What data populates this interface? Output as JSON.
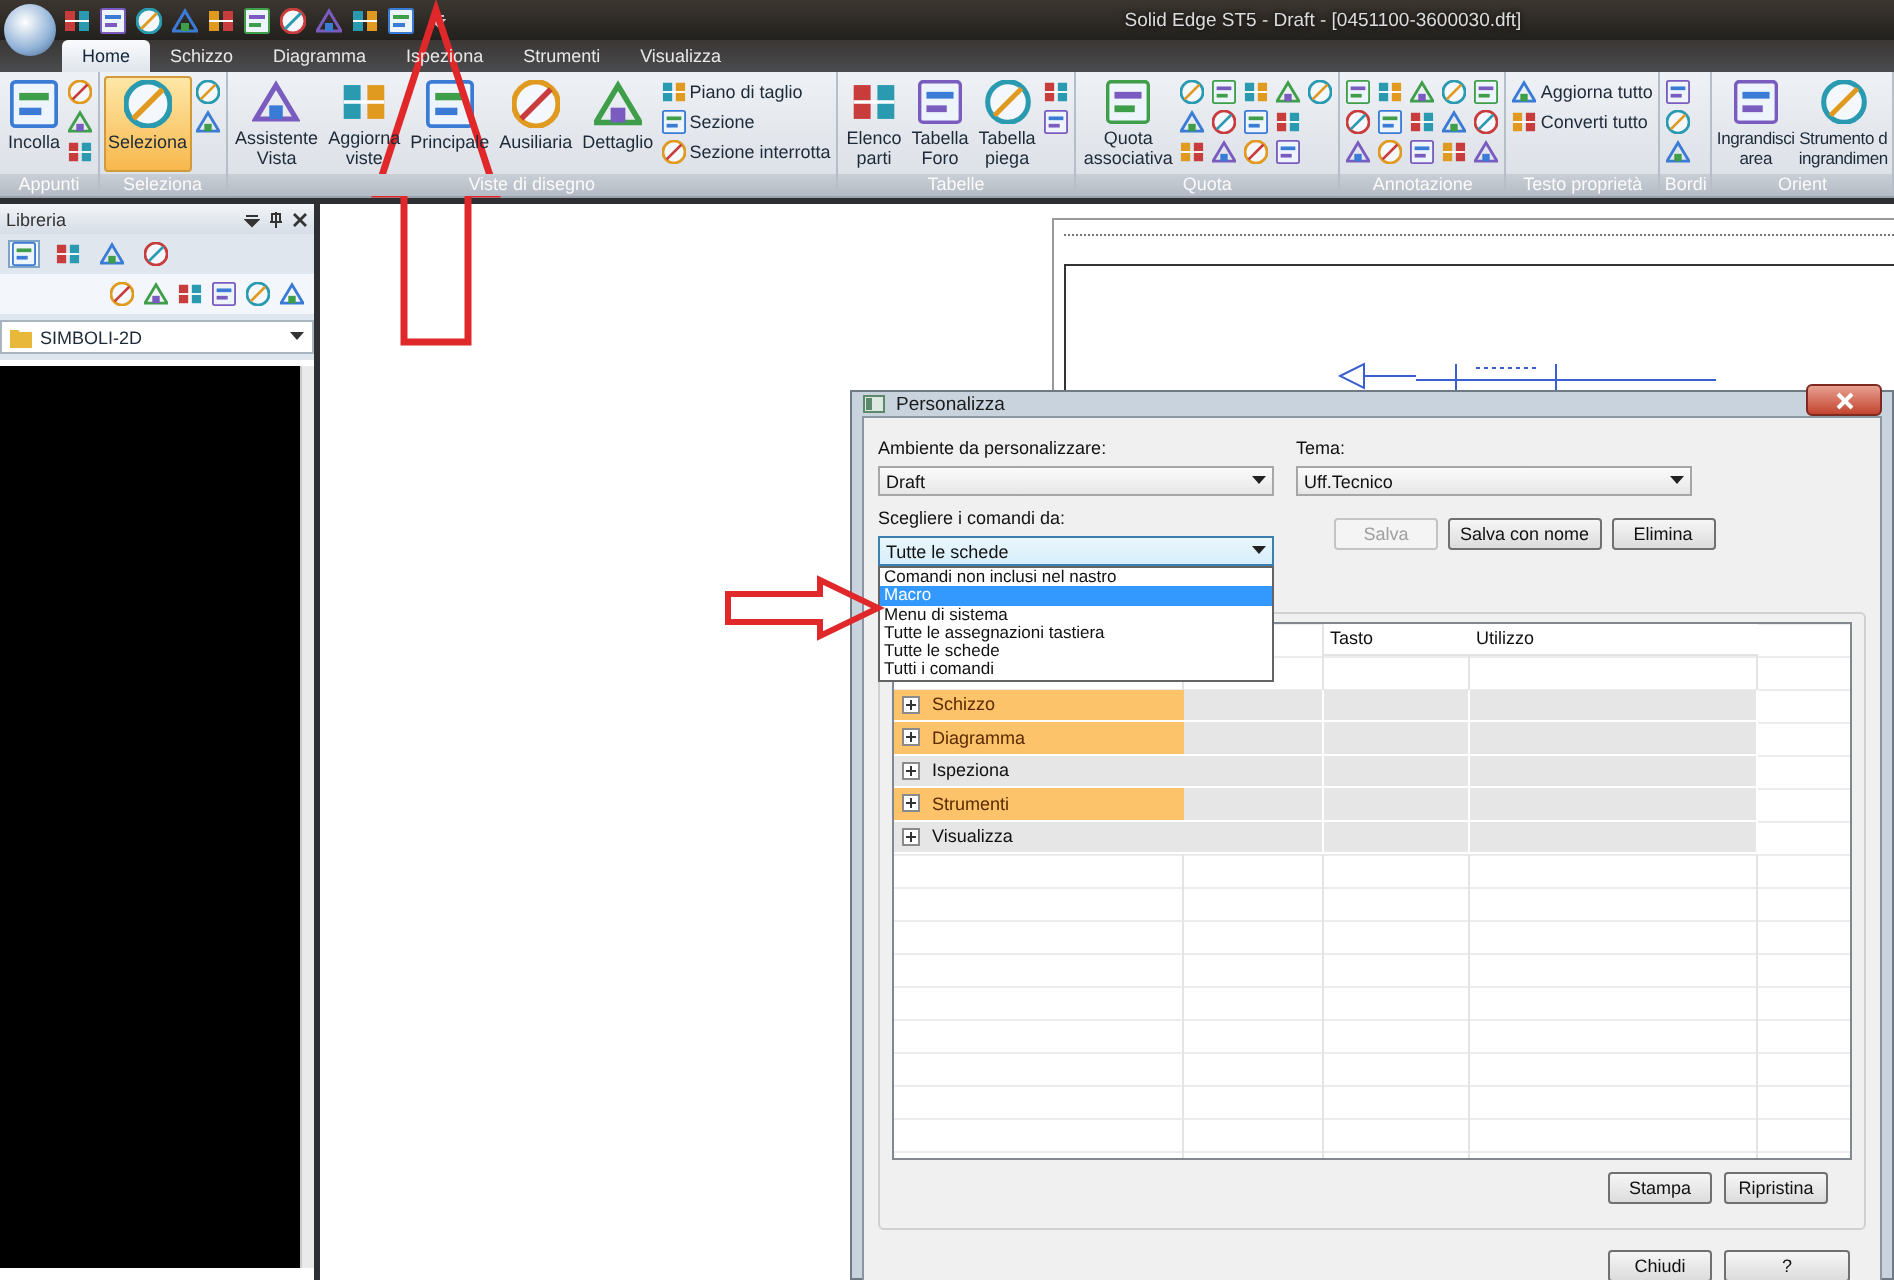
{
  "window": {
    "title": "Solid Edge ST5 - Draft - [0451100-3600030.dft]"
  },
  "tabs": [
    {
      "label": "Home",
      "selected": true
    },
    {
      "label": "Schizzo",
      "selected": false
    },
    {
      "label": "Diagramma",
      "selected": false
    },
    {
      "label": "Ispeziona",
      "selected": false
    },
    {
      "label": "Strumenti",
      "selected": false
    },
    {
      "label": "Visualizza",
      "selected": false
    }
  ],
  "ribbon": {
    "groups": [
      {
        "label": "Appunti",
        "items": [
          {
            "kind": "large",
            "label": "Incolla",
            "selected": false
          },
          {
            "kind": "icon",
            "selected": false
          },
          {
            "kind": "icon",
            "selected": false
          },
          {
            "kind": "icon",
            "selected": false
          }
        ]
      },
      {
        "label": "Seleziona",
        "items": [
          {
            "kind": "large",
            "label": "Seleziona",
            "selected": true
          },
          {
            "kind": "icon",
            "selected": false
          },
          {
            "kind": "icon",
            "selected": false
          }
        ]
      },
      {
        "label": "Viste di disegno",
        "items": [
          {
            "kind": "large",
            "label": "Assistente\nVista",
            "selected": false
          },
          {
            "kind": "large",
            "label": "Aggiorna\nviste",
            "selected": false
          },
          {
            "kind": "large",
            "label": "Principale",
            "selected": false
          },
          {
            "kind": "large",
            "label": "Ausiliaria",
            "selected": false
          },
          {
            "kind": "large",
            "label": "Dettaglio",
            "selected": false
          },
          {
            "kind": "small",
            "label": "Piano di taglio",
            "selected": false
          },
          {
            "kind": "small",
            "label": "Sezione",
            "selected": false
          },
          {
            "kind": "small",
            "label": "Sezione interrotta",
            "selected": false
          }
        ]
      },
      {
        "label": "Tabelle",
        "items": [
          {
            "kind": "large",
            "label": "Elenco\nparti",
            "selected": false
          },
          {
            "kind": "large",
            "label": "Tabella\nForo",
            "selected": false
          },
          {
            "kind": "large",
            "label": "Tabella\npiega",
            "selected": false
          },
          {
            "kind": "icon",
            "selected": false
          },
          {
            "kind": "icon",
            "selected": false
          }
        ]
      },
      {
        "label": "Quota",
        "items": [
          {
            "kind": "large",
            "label": "Quota\nassociativa",
            "selected": false
          },
          {
            "kind": "icon",
            "selected": false
          },
          {
            "kind": "icon",
            "selected": false
          },
          {
            "kind": "icon",
            "selected": false
          },
          {
            "kind": "icon",
            "selected": false
          },
          {
            "kind": "icon",
            "selected": false
          },
          {
            "kind": "icon",
            "selected": false
          },
          {
            "kind": "icon",
            "selected": false
          },
          {
            "kind": "icon",
            "selected": false
          },
          {
            "kind": "icon",
            "selected": false
          },
          {
            "kind": "icon",
            "selected": false
          },
          {
            "kind": "icon",
            "selected": false
          },
          {
            "kind": "icon",
            "selected": false
          },
          {
            "kind": "icon",
            "selected": false
          }
        ]
      },
      {
        "label": "Annotazione",
        "items": [
          {
            "kind": "icon",
            "selected": false
          },
          {
            "kind": "icon",
            "selected": false
          },
          {
            "kind": "icon",
            "selected": false
          },
          {
            "kind": "icon",
            "selected": false
          },
          {
            "kind": "icon",
            "selected": false
          },
          {
            "kind": "icon",
            "selected": false
          },
          {
            "kind": "icon",
            "selected": false
          },
          {
            "kind": "icon",
            "selected": false
          },
          {
            "kind": "icon",
            "selected": false
          },
          {
            "kind": "icon",
            "selected": false
          },
          {
            "kind": "icon",
            "selected": false
          },
          {
            "kind": "icon",
            "selected": false
          },
          {
            "kind": "icon",
            "selected": false
          },
          {
            "kind": "icon",
            "selected": false
          },
          {
            "kind": "icon",
            "selected": false
          }
        ]
      },
      {
        "label": "Testo proprietà",
        "items": [
          {
            "kind": "small",
            "label": "Aggiorna tutto",
            "selected": false
          },
          {
            "kind": "small",
            "label": "Converti tutto",
            "selected": false
          }
        ]
      },
      {
        "label": "Bordi",
        "items": [
          {
            "kind": "icon",
            "selected": false
          },
          {
            "kind": "icon",
            "selected": false
          },
          {
            "kind": "icon",
            "selected": false
          }
        ]
      },
      {
        "label": "Orient",
        "items": [
          {
            "kind": "large",
            "label": "Ingrandisci\narea",
            "selected": false
          },
          {
            "kind": "large",
            "label": "Strumento d\ningrandimen",
            "selected": false
          }
        ]
      }
    ]
  },
  "library": {
    "title": "Libreria",
    "tabs": [
      {
        "selected": true
      },
      {
        "selected": false
      },
      {
        "selected": false
      },
      {
        "selected": false
      }
    ],
    "folder": "SIMBOLI-2D"
  },
  "dialog": {
    "title": "Personalizza",
    "fields": [
      {
        "label": "Ambiente da personalizzare:",
        "value": "Draft",
        "open": false
      },
      {
        "label": "Tema:",
        "value": "Uff.Tecnico",
        "open": false
      },
      {
        "label": "Scegliere i comandi da:",
        "value": "Tutte le schede",
        "open": true
      }
    ],
    "options": [
      {
        "label": "Comandi non inclusi nel nastro",
        "selected": false
      },
      {
        "label": "Macro",
        "selected": true
      },
      {
        "label": "Menu di sistema",
        "selected": false
      },
      {
        "label": "Tutte le assegnazioni tastiera",
        "selected": false
      },
      {
        "label": "Tutte le schede",
        "selected": false
      },
      {
        "label": "Tutti i comandi",
        "selected": false
      }
    ],
    "theme_buttons": [
      {
        "label": "Salva",
        "disabled": true
      },
      {
        "label": "Salva con nome",
        "disabled": false
      },
      {
        "label": "Elimina",
        "disabled": false
      }
    ],
    "table": {
      "columns": [
        {
          "label": "Tasto"
        },
        {
          "label": "Utilizzo"
        }
      ],
      "rows": [
        {
          "label": "Schizzo",
          "highlighted": true,
          "expanded": false
        },
        {
          "label": "Diagramma",
          "highlighted": true,
          "expanded": false
        },
        {
          "label": "Ispeziona",
          "highlighted": false,
          "expanded": false
        },
        {
          "label": "Strumenti",
          "highlighted": true,
          "expanded": false
        },
        {
          "label": "Visualizza",
          "highlighted": false,
          "expanded": false
        }
      ]
    },
    "table_buttons": [
      "Stampa",
      "Ripristina"
    ],
    "footer_buttons": [
      "Chiudi",
      "?"
    ]
  }
}
